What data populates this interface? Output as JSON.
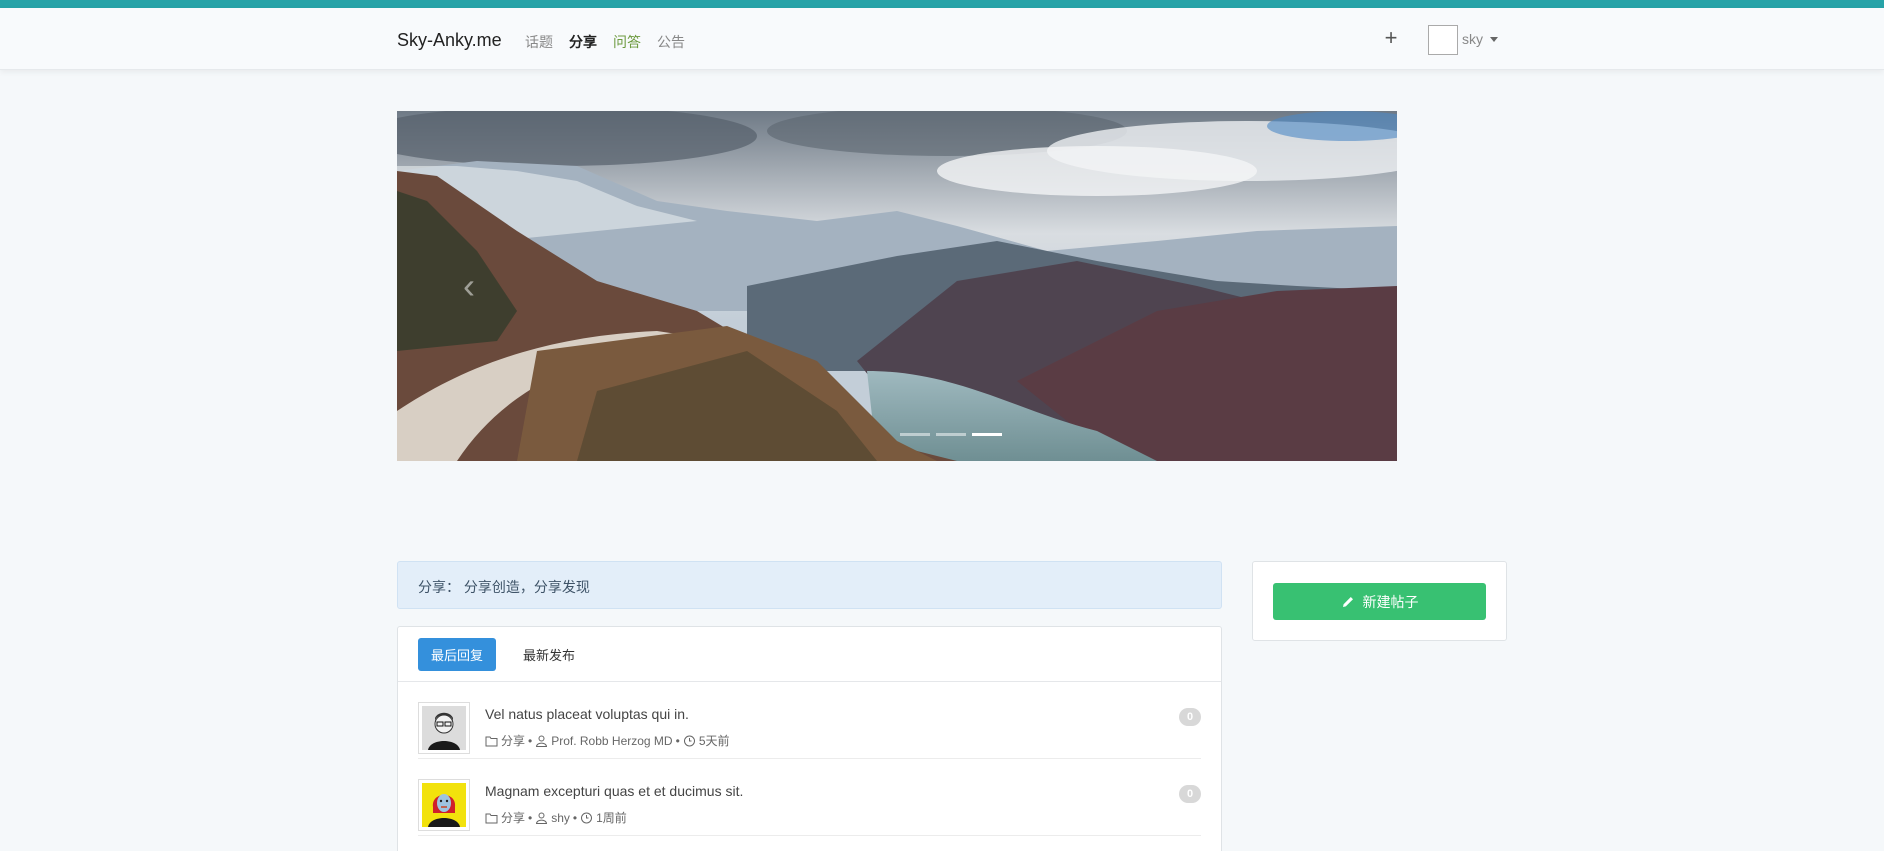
{
  "navbar": {
    "brand": "Sky-Anky.me",
    "links": [
      "话题",
      "分享",
      "问答",
      "公告"
    ],
    "user_name": "sky",
    "plus_label": "+"
  },
  "carousel": {
    "prev_label": "‹",
    "next_label": "›",
    "indicator_count": 3,
    "active_index": 2
  },
  "alert": {
    "text": "分享： 分享创造，分享发现"
  },
  "list": {
    "tabs": [
      "最后回复",
      "最新发布"
    ],
    "topics": [
      {
        "title": "Vel natus placeat voluptas qui in.",
        "category": "分享",
        "author": "Prof. Robb Herzog MD",
        "time": "5天前",
        "replies": "0"
      },
      {
        "title": "Magnam excepturi quas et et ducimus sit.",
        "category": "分享",
        "author": "shy",
        "time": "1周前",
        "replies": "0"
      }
    ],
    "separator": "•"
  },
  "sidebar": {
    "new_post_label": "新建帖子"
  },
  "colors": {
    "accent_top": "#27a3a8",
    "primary": "#3490dc",
    "success": "#38c172"
  }
}
